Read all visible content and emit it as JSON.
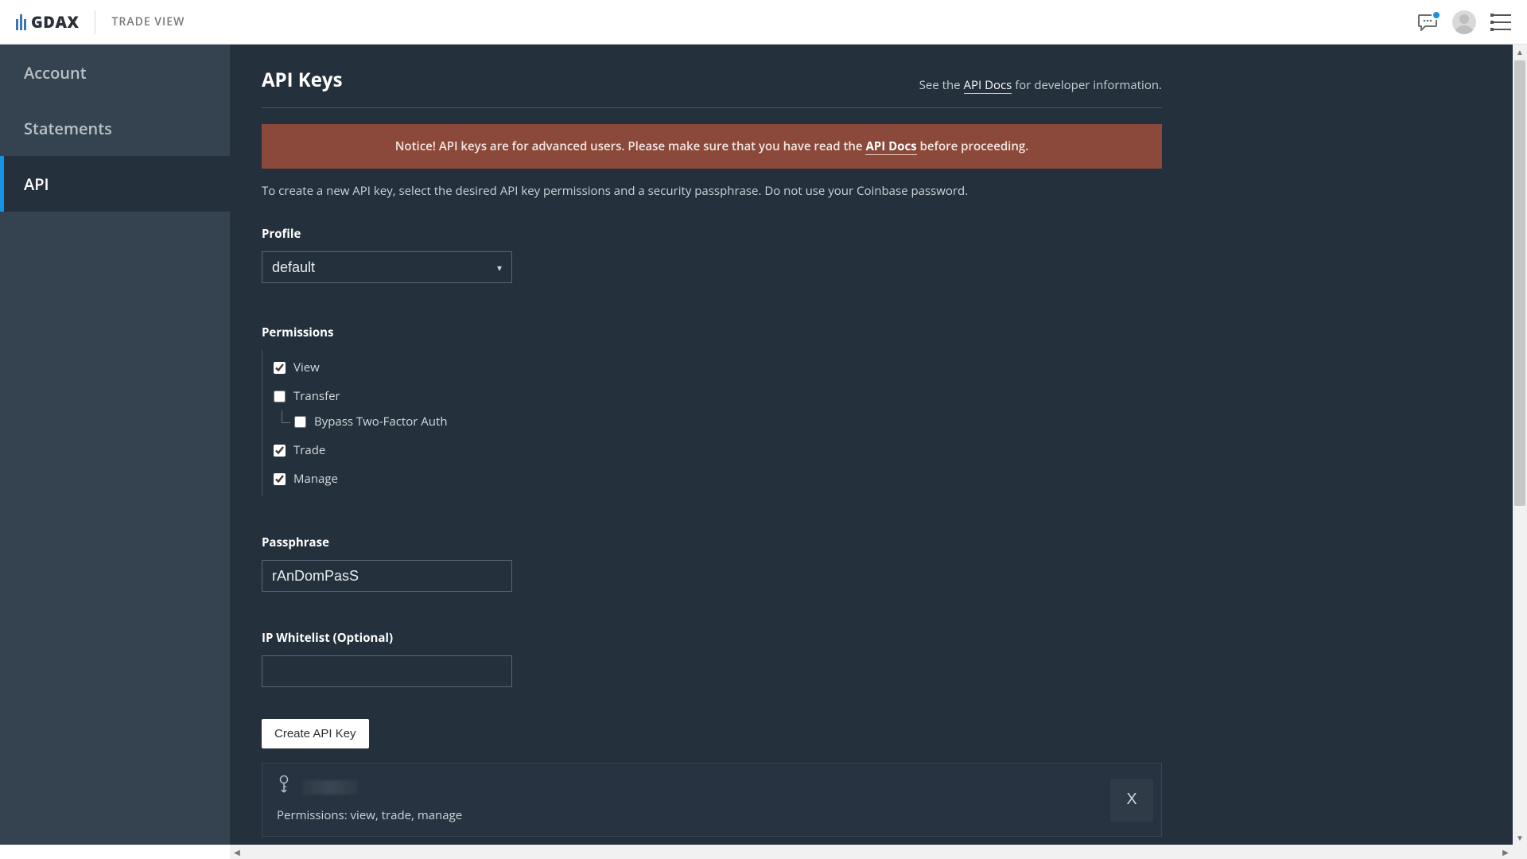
{
  "header": {
    "brand": "GDAX",
    "trade_view": "TRADE VIEW"
  },
  "sidebar": {
    "items": [
      {
        "label": "Account",
        "active": false
      },
      {
        "label": "Statements",
        "active": false
      },
      {
        "label": "API",
        "active": true
      }
    ]
  },
  "page": {
    "title": "API Keys",
    "docs_prefix": "See the ",
    "docs_link": "API Docs",
    "docs_suffix": " for developer information."
  },
  "notice": {
    "prefix": "Notice! API keys are for advanced users. Please make sure that you have read the ",
    "link": "API Docs",
    "suffix": " before proceeding."
  },
  "intro": "To create a new API key, select the desired API key permissions and a security passphrase. Do not use your Coinbase password.",
  "form": {
    "profile_label": "Profile",
    "profile_value": "default",
    "permissions_label": "Permissions",
    "permissions": {
      "view": {
        "label": "View",
        "checked": true
      },
      "transfer": {
        "label": "Transfer",
        "checked": false
      },
      "bypass": {
        "label": "Bypass Two-Factor Auth",
        "checked": false
      },
      "trade": {
        "label": "Trade",
        "checked": true
      },
      "manage": {
        "label": "Manage",
        "checked": true
      }
    },
    "passphrase_label": "Passphrase",
    "passphrase_value": "rAnDomPasS",
    "ip_label": "IP Whitelist (Optional)",
    "ip_value": "",
    "create_label": "Create API Key"
  },
  "existing_key": {
    "perm_line": "Permissions: view, trade, manage",
    "delete_label": "X"
  }
}
